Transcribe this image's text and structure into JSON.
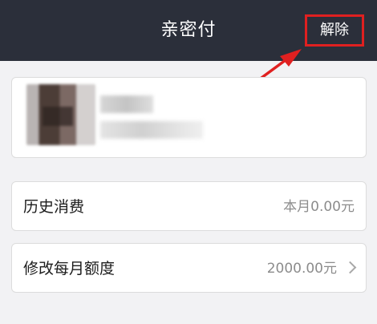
{
  "header": {
    "title": "亲密付",
    "remove_label": "解除"
  },
  "rows": {
    "history": {
      "label": "历史消费",
      "value": "本月0.00元"
    },
    "limit": {
      "label": "修改每月额度",
      "value": "2000.00元"
    }
  },
  "colors": {
    "header_bg": "#2b2f3a",
    "highlight": "#e02020",
    "page_bg": "#f2f2f4"
  },
  "icons": {
    "limit_chevron": "chevron-right-icon",
    "annotation": "red-arrow-annotation"
  }
}
